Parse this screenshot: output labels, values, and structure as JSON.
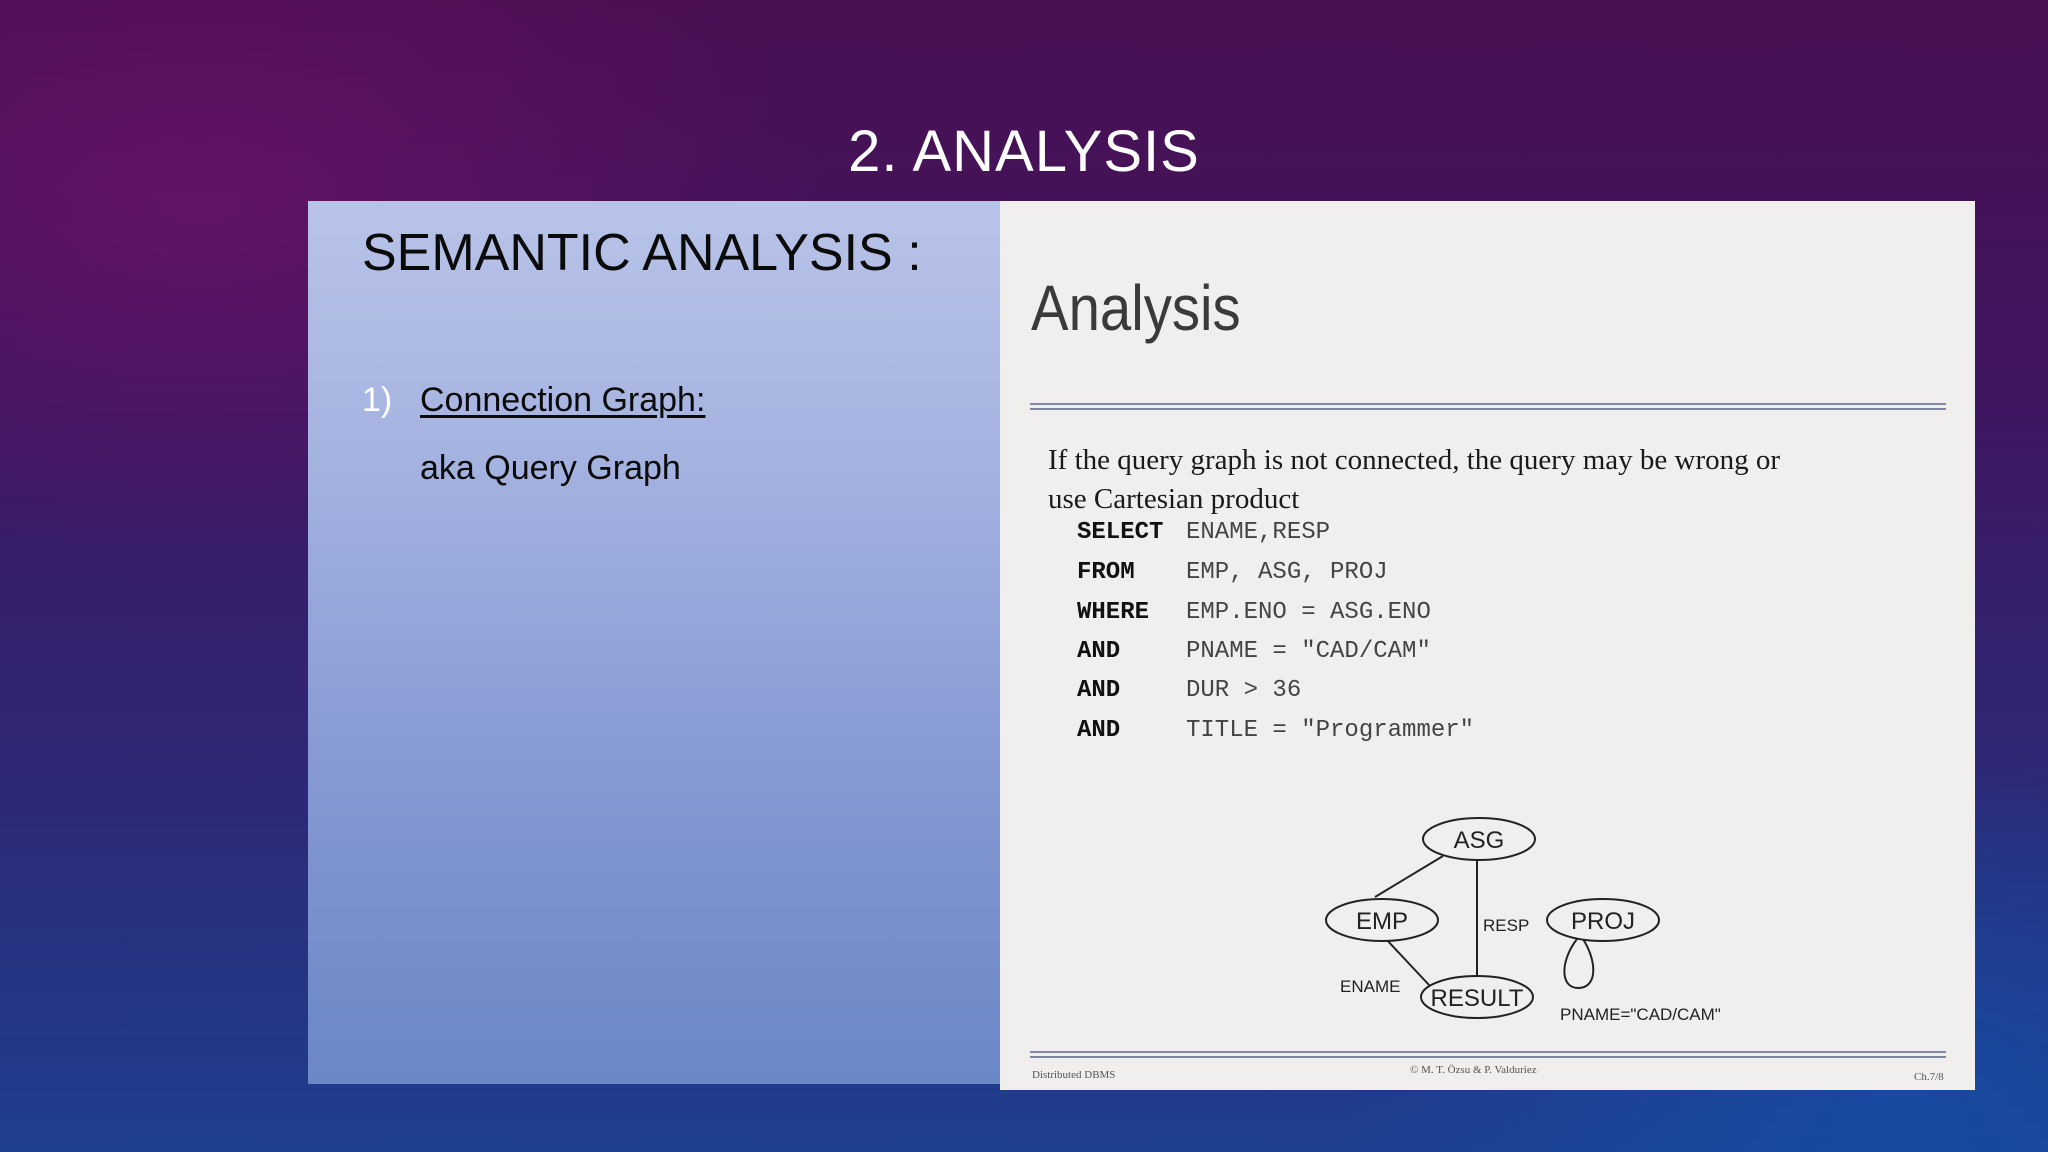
{
  "slide": {
    "title": "2. ANALYSIS"
  },
  "left_panel": {
    "heading": "SEMANTIC ANALYSIS :",
    "item_number": "1)",
    "item_label": "Connection Graph:",
    "item_sub": "aka Query Graph"
  },
  "embedded_slide": {
    "title": "Analysis",
    "paragraph_line1": "If the query graph is not connected, the query may be wrong or",
    "paragraph_line2": "use Cartesian product",
    "sql": [
      {
        "keyword": "SELECT",
        "rest": "ENAME,RESP"
      },
      {
        "keyword": "FROM",
        "rest": "EMP, ASG, PROJ"
      },
      {
        "keyword": "WHERE",
        "rest": "EMP.ENO = ASG.ENO"
      },
      {
        "keyword": "AND",
        "rest": "PNAME = \"CAD/CAM\""
      },
      {
        "keyword": "AND",
        "rest": "DUR > 36"
      },
      {
        "keyword": "AND",
        "rest": "TITLE = \"Programmer\""
      }
    ],
    "graph": {
      "nodes": [
        "ASG",
        "EMP",
        "RESULT",
        "PROJ"
      ],
      "edge_labels": {
        "asg_result": "RESP",
        "emp_result": "ENAME",
        "proj_self": "PNAME=\"CAD/CAM\""
      }
    },
    "footer": {
      "left": "Distributed DBMS",
      "center": "© M. T. Özsu & P. Valduriez",
      "right": "Ch.7/8"
    }
  }
}
